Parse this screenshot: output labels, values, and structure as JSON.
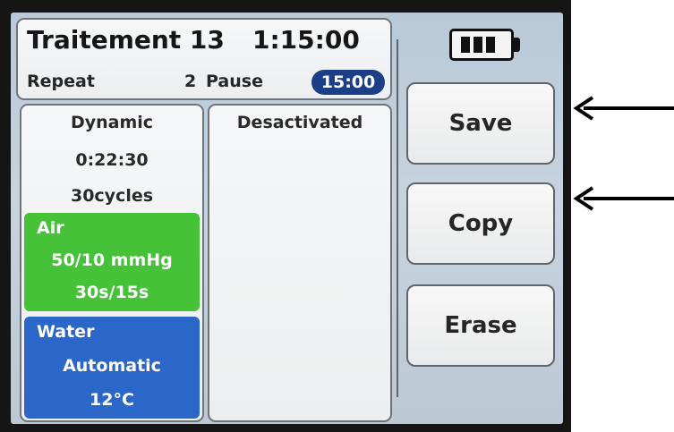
{
  "header": {
    "title": "Traitement 13",
    "time": "1:15:00",
    "repeat_label": "Repeat",
    "repeat_value": "2",
    "pause_label": "Pause",
    "pause_value": "15:00"
  },
  "column1": {
    "mode": "Dynamic",
    "duration": "0:22:30",
    "cycles": "30cycles",
    "air": {
      "label": "Air",
      "pressure": "50/10 mmHg",
      "timing": "30s/15s",
      "color": "#46c238"
    },
    "water": {
      "label": "Water",
      "mode": "Automatic",
      "temperature": "12°C",
      "color": "#2b66c9"
    }
  },
  "column2": {
    "status": "Desactivated"
  },
  "battery": {
    "icon": "battery-full-icon",
    "bars": 3
  },
  "buttons": {
    "save": "Save",
    "copy": "Copy",
    "erase": "Erase"
  },
  "annotations": {
    "arrow_icon": "left-arrow-icon",
    "count": 2
  }
}
